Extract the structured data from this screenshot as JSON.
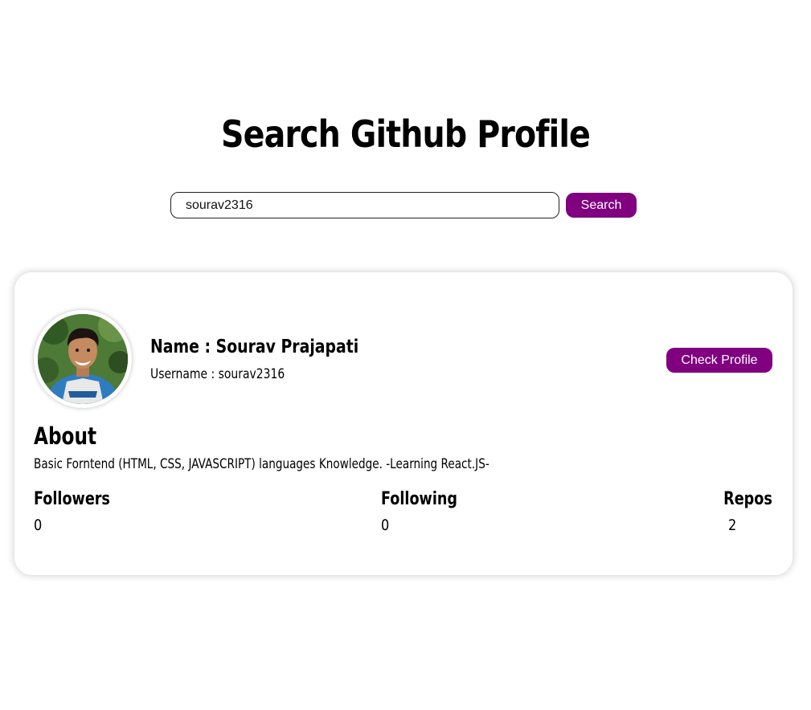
{
  "header": {
    "title": "Search Github Profile"
  },
  "search": {
    "value": "sourav2316",
    "button_label": "Search"
  },
  "profile": {
    "name": "Name : Sourav Prajapati",
    "username": "Username : sourav2316",
    "check_button_label": "Check Profile",
    "about_heading": "About",
    "about_text": "Basic Forntend (HTML, CSS, JAVASCRIPT) languages Knowledge. -Learning React.JS-",
    "stats": {
      "followers_label": "Followers",
      "followers_value": "0",
      "following_label": "Following",
      "following_value": "0",
      "repos_label": "Repos",
      "repos_value": "2"
    }
  },
  "colors": {
    "accent": "#800080",
    "background": "#ffffff",
    "text": "#000000"
  }
}
